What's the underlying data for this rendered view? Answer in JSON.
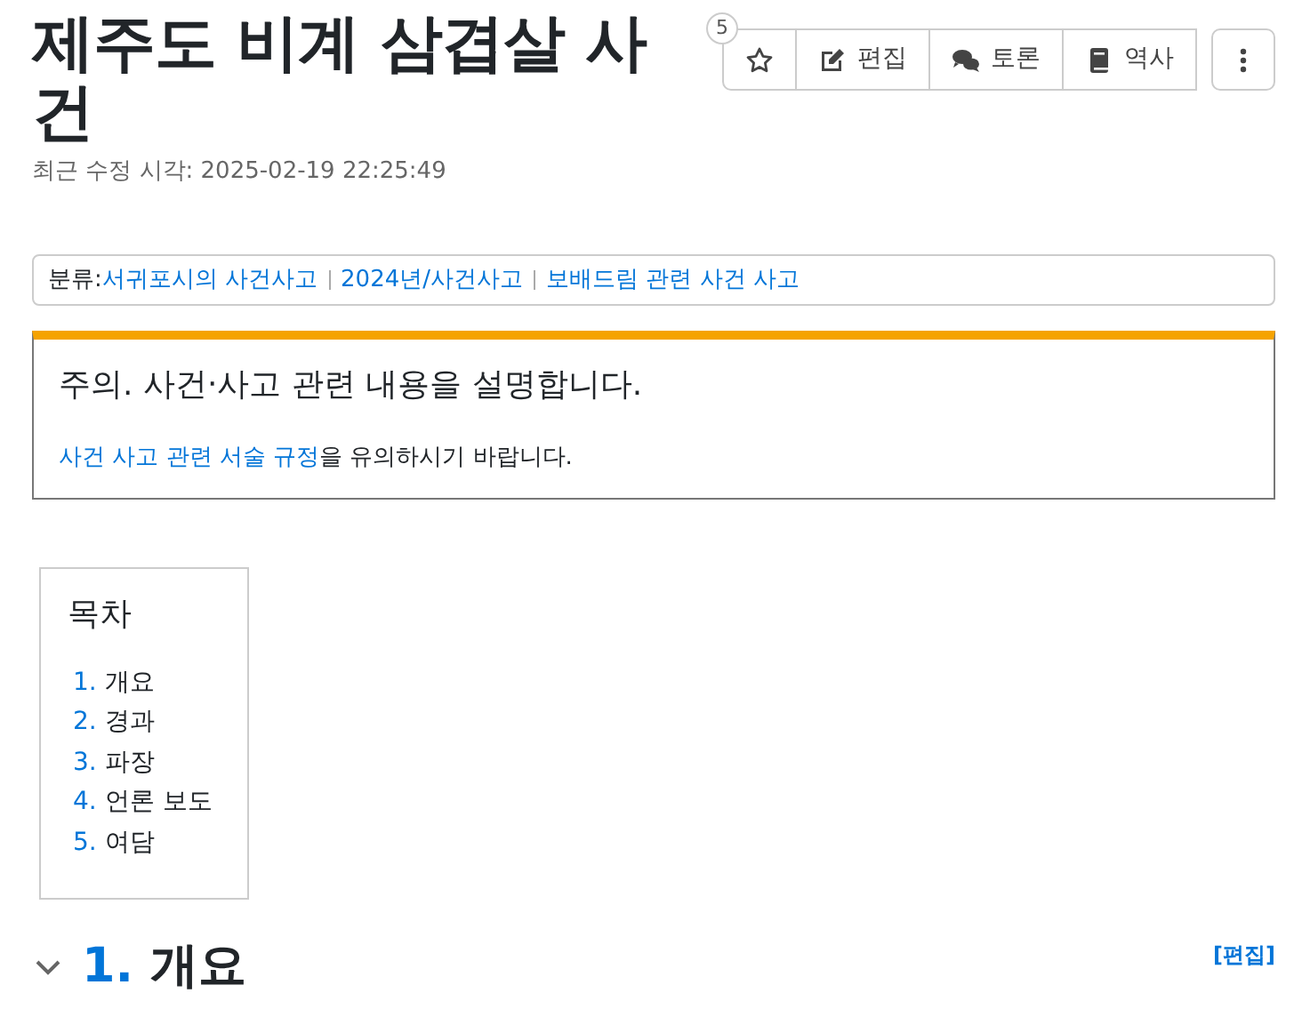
{
  "title": "제주도 비계 삼겹살 사건",
  "star_count": "5",
  "actions": [
    {
      "kind": "star"
    },
    {
      "kind": "edit",
      "label": "편집"
    },
    {
      "kind": "discuss",
      "label": "토론"
    },
    {
      "kind": "history",
      "label": "역사"
    }
  ],
  "last_modified": "최근 수정 시각: 2025-02-19 22:25:49",
  "categories": {
    "label": "분류:",
    "items": [
      "서귀포시의 사건사고",
      "2024년/사건사고",
      "보배드림 관련 사건 사고"
    ]
  },
  "notice": {
    "title": "주의. 사건·사고 관련 내용을 설명합니다.",
    "link": "사건 사고 관련 서술 규정",
    "text": "을 유의하시기 바랍니다."
  },
  "toc": {
    "title": "목차",
    "items": [
      {
        "number": "1.",
        "label": "개요"
      },
      {
        "number": "2.",
        "label": "경과"
      },
      {
        "number": "3.",
        "label": "파장"
      },
      {
        "number": "4.",
        "label": "언론 보도"
      },
      {
        "number": "5.",
        "label": "여담"
      }
    ]
  },
  "section": {
    "number": "1.",
    "title": "개요",
    "expanded": true,
    "edit": "[편집]"
  }
}
